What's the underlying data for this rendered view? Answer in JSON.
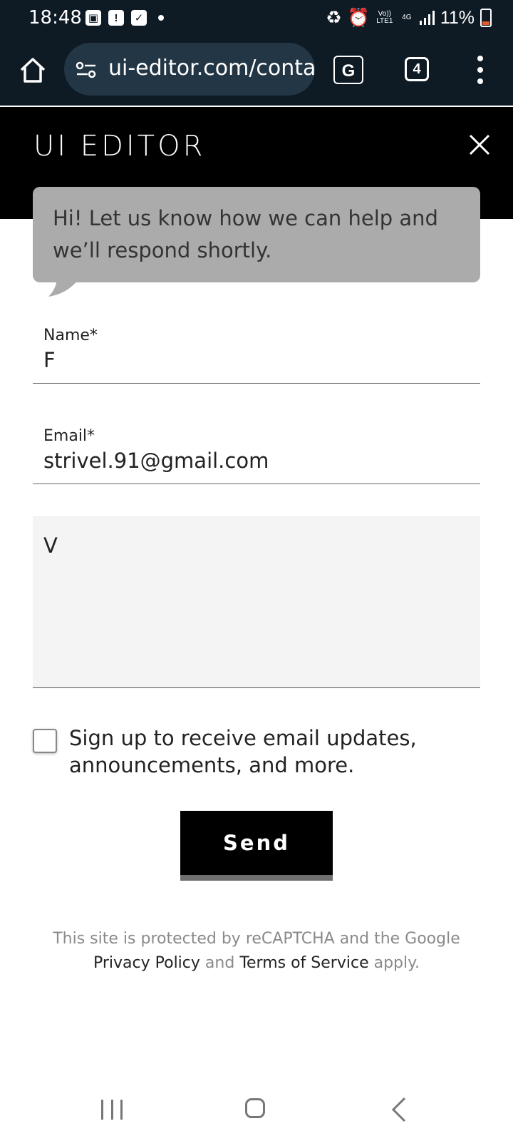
{
  "status_bar": {
    "time": "18:48",
    "battery": "11%",
    "network": "4G",
    "volte": "Vo)) LTE1",
    "icons": [
      "image-icon",
      "alert-icon",
      "check-icon",
      "dot-icon",
      "battery-saver-icon",
      "alarm-icon",
      "signal-icon",
      "battery-icon"
    ]
  },
  "browser": {
    "url": "ui-editor.com/contac",
    "tab_count": "4",
    "translate_label": "G"
  },
  "header": {
    "title": "UI EDITOR"
  },
  "bubble": {
    "text": "Hi! Let us know how we can help and we’ll respond shortly."
  },
  "form": {
    "name_label": "Name*",
    "name_value": "F",
    "email_label": "Email*",
    "email_value": "strivel.91@gmail.com",
    "message_value": "V",
    "checkbox_label": "Sign up to receive email updates, announcements, and more.",
    "checkbox_checked": false,
    "send_label": "Send"
  },
  "recaptcha": {
    "line1": "This site is protected by reCAPTCHA and the Google",
    "privacy": "Privacy Policy",
    "and": " and ",
    "terms": "Terms of Service",
    "apply": " apply."
  },
  "colors": {
    "chrome_bg": "#0e1a24",
    "url_pill": "#233645",
    "header_bg": "#000000",
    "bubble_bg": "#ababab",
    "message_bg": "#f4f4f4",
    "send_border": "#6f6f6f"
  }
}
